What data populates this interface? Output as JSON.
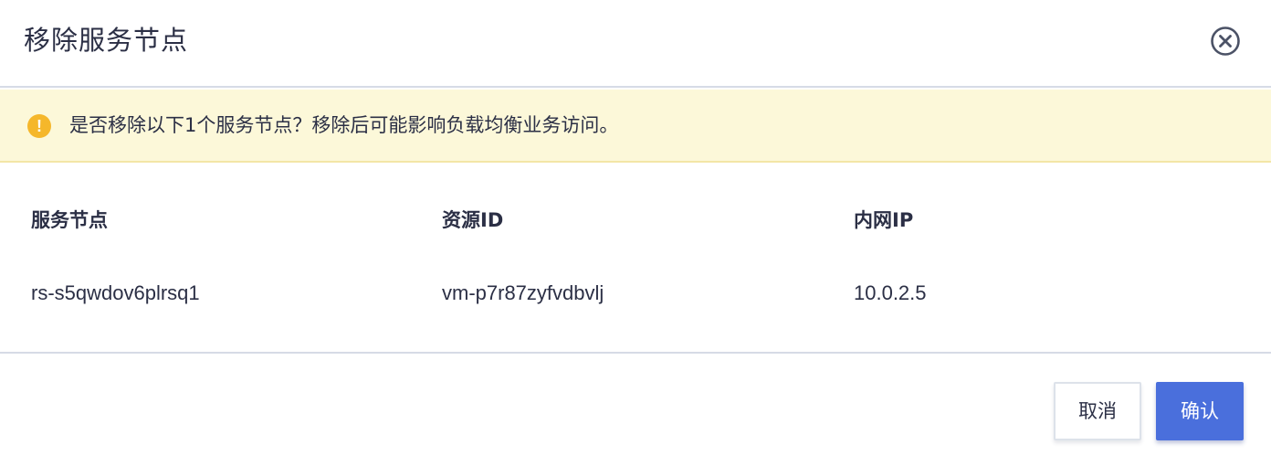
{
  "dialog": {
    "title": "移除服务节点",
    "close_icon": "close-circle-icon"
  },
  "warning": {
    "icon": "exclamation-icon",
    "icon_glyph": "!",
    "text": "是否移除以下1个服务节点？移除后可能影响负载均衡业务访问。"
  },
  "table": {
    "headers": [
      "服务节点",
      "资源ID",
      "内网IP"
    ],
    "rows": [
      [
        "rs-s5qwdov6plrsq1",
        "vm-p7r87zyfvdbvlj",
        "10.0.2.5"
      ]
    ]
  },
  "footer": {
    "cancel_label": "取消",
    "confirm_label": "确认"
  },
  "colors": {
    "accent": "#4a6fdc",
    "warning_bg": "#fcf8d9",
    "warning_icon": "#f5b72b"
  }
}
